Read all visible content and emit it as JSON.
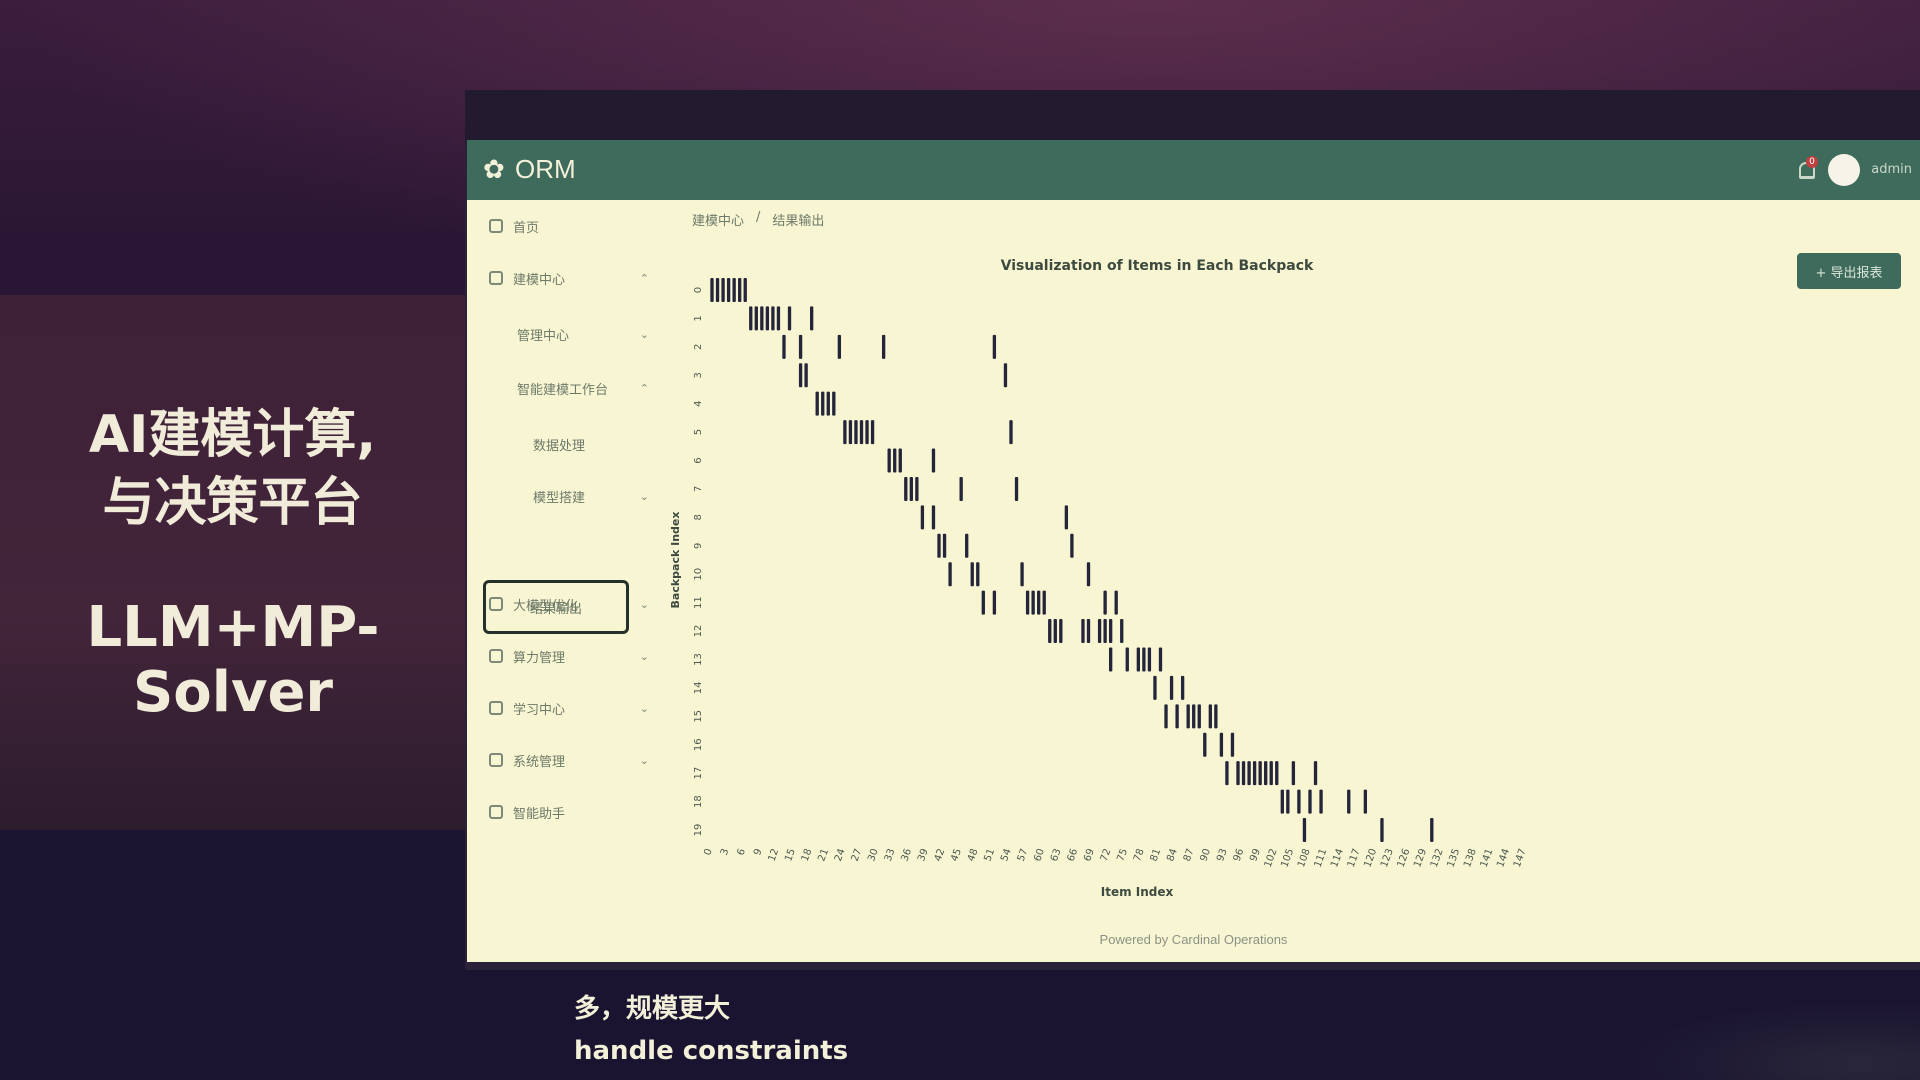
{
  "slide": {
    "headline_line1": "AI建模计算,",
    "headline_line2": "与决策平台",
    "headline_line3": "LLM+MP-Solver",
    "subtitle_cn": "多，规模更大",
    "subtitle_en": "handle constraints"
  },
  "app": {
    "logo_text": "ORM",
    "notification_count": "0",
    "user_name": "admin",
    "breadcrumb": [
      "建模中心",
      "结果输出"
    ],
    "export_button": "+ 导出报表",
    "footer": "Powered by Cardinal Operations",
    "colors": {
      "header": "#3f6b5c",
      "background": "#f8f5d2",
      "mark": "#24243a"
    }
  },
  "sidebar": {
    "items": [
      {
        "label": "首页",
        "icon": "home-icon",
        "level": 0,
        "chevron": ""
      },
      {
        "label": "建模中心",
        "icon": "cube-icon",
        "level": 0,
        "chevron": "^"
      },
      {
        "label": "管理中心",
        "icon": "",
        "level": 1,
        "chevron": "v"
      },
      {
        "label": "智能建模工作台",
        "icon": "",
        "level": 1,
        "chevron": "^"
      },
      {
        "label": "数据处理",
        "icon": "",
        "level": 2,
        "chevron": ""
      },
      {
        "label": "模型搭建",
        "icon": "",
        "level": 2,
        "chevron": "v"
      },
      {
        "label": "结果输出",
        "icon": "",
        "level": 2,
        "chevron": "",
        "active": true
      },
      {
        "label": "大模型优化",
        "icon": "cube-icon",
        "level": 0,
        "chevron": "v"
      },
      {
        "label": "算力管理",
        "icon": "cube-icon",
        "level": 0,
        "chevron": "v"
      },
      {
        "label": "学习中心",
        "icon": "grid-icon",
        "level": 0,
        "chevron": "v"
      },
      {
        "label": "系统管理",
        "icon": "grid-icon",
        "level": 0,
        "chevron": "v"
      },
      {
        "label": "智能助手",
        "icon": "chat-icon",
        "level": 0,
        "chevron": ""
      }
    ]
  },
  "chart_data": {
    "type": "scatter",
    "title": "Visualization of Items in Each Backpack",
    "xlabel": "Item Index",
    "ylabel": "Backpack Index",
    "xlim": [
      0,
      149
    ],
    "ylim": [
      0,
      19
    ],
    "x_ticks": [
      0,
      3,
      6,
      9,
      12,
      15,
      18,
      21,
      24,
      27,
      30,
      33,
      36,
      39,
      42,
      45,
      48,
      51,
      54,
      57,
      60,
      63,
      66,
      69,
      72,
      75,
      78,
      81,
      84,
      87,
      90,
      93,
      96,
      99,
      102,
      105,
      108,
      111,
      114,
      117,
      120,
      123,
      126,
      129,
      132,
      135,
      138,
      141,
      144,
      147
    ],
    "y_ticks": [
      0,
      1,
      2,
      3,
      4,
      5,
      6,
      7,
      8,
      9,
      10,
      11,
      12,
      13,
      14,
      15,
      16,
      17,
      18,
      19
    ],
    "points": [
      [
        0,
        0
      ],
      [
        1,
        0
      ],
      [
        2,
        0
      ],
      [
        3,
        0
      ],
      [
        4,
        0
      ],
      [
        5,
        0
      ],
      [
        6,
        0
      ],
      [
        7,
        1
      ],
      [
        8,
        1
      ],
      [
        9,
        1
      ],
      [
        10,
        1
      ],
      [
        11,
        1
      ],
      [
        12,
        1
      ],
      [
        14,
        1
      ],
      [
        18,
        1
      ],
      [
        13,
        2
      ],
      [
        16,
        2
      ],
      [
        23,
        2
      ],
      [
        31,
        2
      ],
      [
        51,
        2
      ],
      [
        16,
        3
      ],
      [
        17,
        3
      ],
      [
        53,
        3
      ],
      [
        19,
        4
      ],
      [
        20,
        4
      ],
      [
        21,
        4
      ],
      [
        22,
        4
      ],
      [
        24,
        5
      ],
      [
        25,
        5
      ],
      [
        26,
        5
      ],
      [
        27,
        5
      ],
      [
        28,
        5
      ],
      [
        29,
        5
      ],
      [
        54,
        5
      ],
      [
        32,
        6
      ],
      [
        33,
        6
      ],
      [
        34,
        6
      ],
      [
        40,
        6
      ],
      [
        35,
        7
      ],
      [
        36,
        7
      ],
      [
        37,
        7
      ],
      [
        45,
        7
      ],
      [
        55,
        7
      ],
      [
        38,
        8
      ],
      [
        40,
        8
      ],
      [
        64,
        8
      ],
      [
        41,
        9
      ],
      [
        42,
        9
      ],
      [
        46,
        9
      ],
      [
        65,
        9
      ],
      [
        43,
        10
      ],
      [
        47,
        10
      ],
      [
        48,
        10
      ],
      [
        56,
        10
      ],
      [
        68,
        10
      ],
      [
        49,
        11
      ],
      [
        51,
        11
      ],
      [
        57,
        11
      ],
      [
        58,
        11
      ],
      [
        59,
        11
      ],
      [
        60,
        11
      ],
      [
        71,
        11
      ],
      [
        73,
        11
      ],
      [
        61,
        12
      ],
      [
        62,
        12
      ],
      [
        63,
        12
      ],
      [
        67,
        12
      ],
      [
        68,
        12
      ],
      [
        70,
        12
      ],
      [
        71,
        12
      ],
      [
        72,
        12
      ],
      [
        74,
        12
      ],
      [
        72,
        13
      ],
      [
        75,
        13
      ],
      [
        77,
        13
      ],
      [
        78,
        13
      ],
      [
        79,
        13
      ],
      [
        81,
        13
      ],
      [
        80,
        14
      ],
      [
        83,
        14
      ],
      [
        85,
        14
      ],
      [
        82,
        15
      ],
      [
        84,
        15
      ],
      [
        86,
        15
      ],
      [
        87,
        15
      ],
      [
        88,
        15
      ],
      [
        90,
        15
      ],
      [
        91,
        15
      ],
      [
        89,
        16
      ],
      [
        92,
        16
      ],
      [
        94,
        16
      ],
      [
        93,
        17
      ],
      [
        95,
        17
      ],
      [
        96,
        17
      ],
      [
        97,
        17
      ],
      [
        98,
        17
      ],
      [
        99,
        17
      ],
      [
        100,
        17
      ],
      [
        101,
        17
      ],
      [
        102,
        17
      ],
      [
        105,
        17
      ],
      [
        109,
        17
      ],
      [
        103,
        18
      ],
      [
        104,
        18
      ],
      [
        106,
        18
      ],
      [
        108,
        18
      ],
      [
        110,
        18
      ],
      [
        115,
        18
      ],
      [
        118,
        18
      ],
      [
        107,
        19
      ],
      [
        121,
        19
      ],
      [
        130,
        19
      ]
    ]
  }
}
